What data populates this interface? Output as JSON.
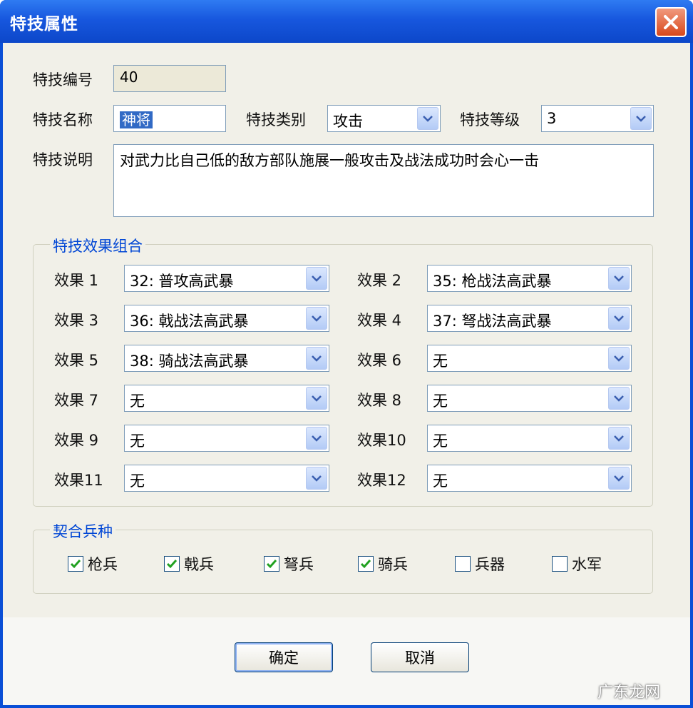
{
  "window": {
    "title": "特技属性"
  },
  "fields": {
    "id_label": "特技编号",
    "id_value": "40",
    "name_label": "特技名称",
    "name_value": "神将",
    "category_label": "特技类别",
    "category_value": "攻击",
    "level_label": "特技等级",
    "level_value": "3",
    "desc_label": "特技说明",
    "desc_value": "对武力比自己低的敌方部队施展一般攻击及战法成功时会心一击"
  },
  "effects_group": {
    "title": "特技效果组合",
    "items": [
      {
        "label": "效果 1",
        "value": "32: 普攻高武暴"
      },
      {
        "label": "效果 2",
        "value": "35: 枪战法高武暴"
      },
      {
        "label": "效果 3",
        "value": "36: 戟战法高武暴"
      },
      {
        "label": "效果 4",
        "value": "37: 弩战法高武暴"
      },
      {
        "label": "效果 5",
        "value": "38: 骑战法高武暴"
      },
      {
        "label": "效果 6",
        "value": "无"
      },
      {
        "label": "效果 7",
        "value": "无"
      },
      {
        "label": "效果 8",
        "value": "无"
      },
      {
        "label": "效果 9",
        "value": "无"
      },
      {
        "label": "效果10",
        "value": "无"
      },
      {
        "label": "效果11",
        "value": "无"
      },
      {
        "label": "效果12",
        "value": "无"
      }
    ]
  },
  "troops_group": {
    "title": "契合兵种",
    "items": [
      {
        "label": "枪兵",
        "checked": true
      },
      {
        "label": "戟兵",
        "checked": true
      },
      {
        "label": "弩兵",
        "checked": true
      },
      {
        "label": "骑兵",
        "checked": true
      },
      {
        "label": "兵器",
        "checked": false
      },
      {
        "label": "水军",
        "checked": false
      }
    ]
  },
  "buttons": {
    "ok": "确定",
    "cancel": "取消"
  },
  "watermark": "广东龙网",
  "colors": {
    "title_bar": "#1757de",
    "group_title": "#0046d5",
    "close_button": "#d8481c"
  }
}
